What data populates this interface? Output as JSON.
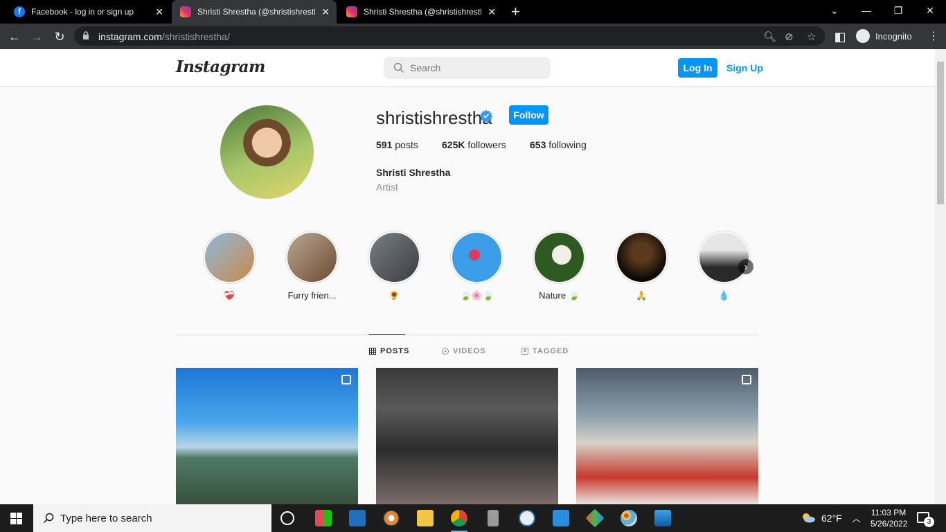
{
  "browser": {
    "tabs": [
      {
        "title": "Facebook - log in or sign up",
        "icon": "facebook-icon"
      },
      {
        "title": "Shristi Shrestha (@shristishrestha",
        "icon": "instagram-icon"
      },
      {
        "title": "Shristi Shrestha (@shristishrestha",
        "icon": "instagram-icon"
      }
    ],
    "url_domain": "instagram.com",
    "url_path": "/shristishrestha/",
    "incognito_label": "Incognito"
  },
  "header": {
    "logo": "Instagram",
    "search_placeholder": "Search",
    "login_label": "Log In",
    "signup_label": "Sign Up"
  },
  "profile": {
    "username": "shristishrestha",
    "follow_label": "Follow",
    "posts_count": "591",
    "posts_label": "posts",
    "followers_count": "625K",
    "followers_label": "followers",
    "following_count": "653",
    "following_label": "following",
    "full_name": "Shristi Shrestha",
    "category": "Artist"
  },
  "highlights": [
    {
      "label": "❤️‍🩹",
      "colors": [
        "#8fb8d8",
        "#c98a4b"
      ]
    },
    {
      "label": "Furry frien...",
      "colors": [
        "#b8a792",
        "#6e4a33"
      ]
    },
    {
      "label": "🌻",
      "colors": [
        "#7a7f85",
        "#3a3d40"
      ]
    },
    {
      "label": "🍃🌸🍃",
      "colors": [
        "#3c9de8",
        "#e23b5a"
      ]
    },
    {
      "label": "Nature 🍃",
      "colors": [
        "#f2efe6",
        "#2e5a22"
      ]
    },
    {
      "label": "🙏",
      "colors": [
        "#5a3a1c",
        "#0c0805"
      ]
    },
    {
      "label": "💧",
      "colors": [
        "#e6e6e6",
        "#2a2a2a"
      ]
    }
  ],
  "post_tabs": [
    {
      "label": "POSTS",
      "icon": "grid-icon"
    },
    {
      "label": "VIDEOS",
      "icon": "play-icon"
    },
    {
      "label": "TAGGED",
      "icon": "tag-icon"
    }
  ],
  "taskbar": {
    "search_placeholder": "Type here to search",
    "temperature": "62°F",
    "time": "11:03 PM",
    "date": "5/26/2022",
    "notification_count": "3"
  }
}
